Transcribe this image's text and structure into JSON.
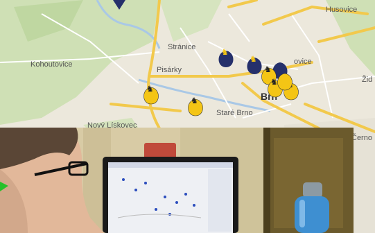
{
  "map": {
    "labels": {
      "kohoutovice": "Kohoutovice",
      "stranice": "Stránice",
      "pisarky": "Pisárky",
      "stare_brno": "Staré Brno",
      "novy_liskovec": "Nový Lískovec",
      "husovice": "Husovice",
      "brno": "Brn",
      "cernovice": "Černo",
      "zid": "Žid",
      "kovice": "ovice"
    },
    "colors": {
      "land": "#ece8dc",
      "park": "#cfe0b5",
      "road_major": "#f2c94c",
      "road_minor": "#ffffff",
      "marker_yellow": "#f4c515",
      "marker_navy": "#25306b",
      "water": "#a9c8e6"
    }
  },
  "photo": {
    "colors": {
      "wall": "#d8cba5",
      "door": "#6b5a2c",
      "laptop": "#1a1a1a",
      "bottle": "#3e8fd1"
    },
    "screen": {
      "marker_color": "#2b4dbd"
    }
  }
}
